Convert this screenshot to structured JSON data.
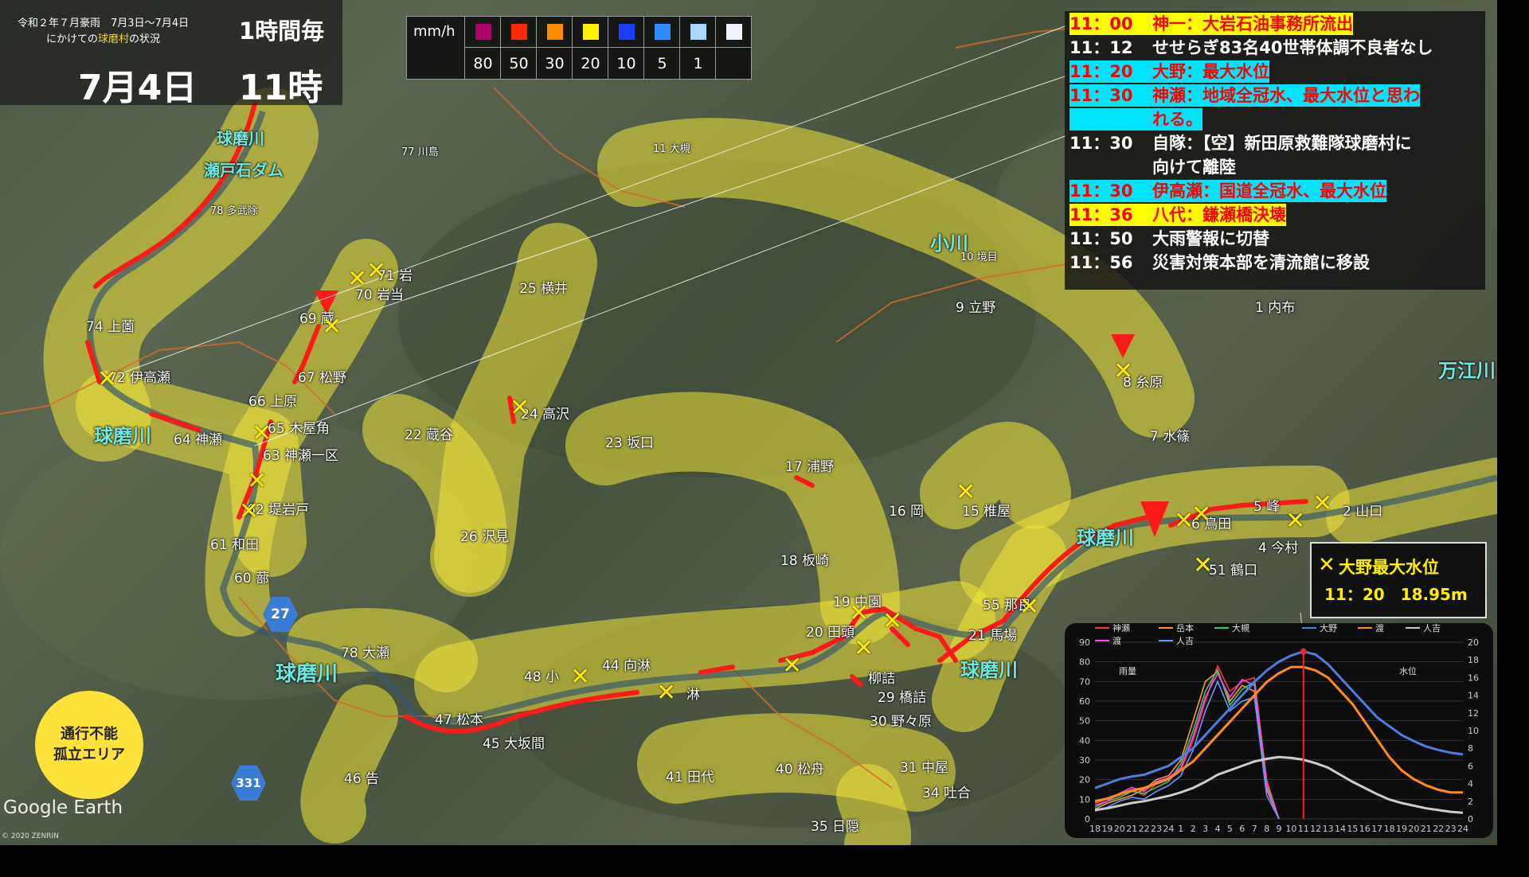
{
  "title": {
    "line1": "令和２年７月豪雨　7月3日～7月4日",
    "line2_prefix": "にかけての",
    "line2_highlight": "球磨村",
    "line2_suffix": "の状況",
    "interval": "1時間毎",
    "date": "7月4日",
    "hour": "11時"
  },
  "rain_legend": {
    "unit": "mm/h",
    "colors": [
      "#b0006e",
      "#ff2a00",
      "#ff8c00",
      "#fff000",
      "#1a3cff",
      "#2c8cff",
      "#a8d8ff",
      "#f0f4ff"
    ],
    "values": [
      "80",
      "50",
      "30",
      "20",
      "10",
      "5",
      "1",
      ""
    ]
  },
  "timeline": [
    {
      "time": "11：00",
      "text": "神一：大岩石油事務所流出",
      "style": "hl"
    },
    {
      "time": "11：12",
      "text": "せせらぎ83名40世帯体調不良者なし",
      "style": "nrm"
    },
    {
      "time": "11：20",
      "text": "大野：最大水位",
      "style": "hl2"
    },
    {
      "time": "11：30",
      "text": "神瀬：地域全冠水、最大水位と思わ",
      "style": "hl2"
    },
    {
      "time": "",
      "text": "れる。",
      "style": "hl2"
    },
    {
      "time": "11：30",
      "text": "自隊：【空】新田原救難隊球磨村に",
      "style": "nrm"
    },
    {
      "time": "",
      "text": "向けて離陸",
      "style": "nrm"
    },
    {
      "time": "11：30",
      "text": "伊高瀬：国道全冠水、最大水位",
      "style": "hl2"
    },
    {
      "time": "11：36",
      "text": "八代：鎌瀬橋決壊",
      "style": "hl"
    },
    {
      "time": "11：50",
      "text": "大雨警報に切替",
      "style": "nrm"
    },
    {
      "time": "11：56",
      "text": "災害対策本部を清流館に移設",
      "style": "nrm"
    }
  ],
  "callout": {
    "line1": "大野最大水位",
    "time": "11：20",
    "level": "18.95m"
  },
  "isolation_legend": {
    "line1": "通行不能",
    "line2": "孤立エリア"
  },
  "attribution": {
    "google": "Google Earth",
    "copy": "© 2020 ZENRIN"
  },
  "places": [
    {
      "label": "77 川島"
    },
    {
      "label": "78 多武除"
    },
    {
      "label": "74 上薗"
    },
    {
      "label": "72 伊高瀬"
    },
    {
      "label": "71 岩"
    },
    {
      "label": "70 岩当"
    },
    {
      "label": "69 蔵"
    },
    {
      "label": "67 松野"
    },
    {
      "label": "66 上原"
    },
    {
      "label": "65 木屋角"
    },
    {
      "label": "64 神瀬"
    },
    {
      "label": "63 神瀬一区"
    },
    {
      "label": "62 堤岩戸"
    },
    {
      "label": "61 和田"
    },
    {
      "label": "60 蔀"
    },
    {
      "label": "78 大瀬"
    },
    {
      "label": "46 告"
    },
    {
      "label": "47 松本"
    },
    {
      "label": "45 大坂間"
    },
    {
      "label": "48 小"
    },
    {
      "label": "44 向淋"
    },
    {
      "label": "41 田代"
    },
    {
      "label": "40 松舟"
    },
    {
      "label": "35 日隠"
    },
    {
      "label": "34 吐合"
    },
    {
      "label": "31 中屋"
    },
    {
      "label": "30 野々原"
    },
    {
      "label": "29 橋詰"
    },
    {
      "label": "柳詰"
    },
    {
      "label": "19 中園"
    },
    {
      "label": "20 田頭"
    },
    {
      "label": "17 浦野"
    },
    {
      "label": "18 板崎"
    },
    {
      "label": "16 岡"
    },
    {
      "label": "15 椎屋"
    },
    {
      "label": "55 那良"
    },
    {
      "label": "21 馬場"
    },
    {
      "label": "22 蔵谷"
    },
    {
      "label": "23 坂口"
    },
    {
      "label": "25 横井"
    },
    {
      "label": "24 高沢"
    },
    {
      "label": "26 沢見"
    },
    {
      "label": "11 大槻"
    },
    {
      "label": "10 境目"
    },
    {
      "label": "9 立野"
    },
    {
      "label": "8 糸原"
    },
    {
      "label": "7 水篠"
    },
    {
      "label": "1 内布"
    },
    {
      "label": "5 峰"
    },
    {
      "label": "6 鳥田"
    },
    {
      "label": "4 今村"
    },
    {
      "label": "2 山口"
    },
    {
      "label": "51 鶴口"
    },
    {
      "label": "淋"
    }
  ],
  "rivers": [
    "球磨川",
    "瀬戸石ダム",
    "球磨川",
    "球磨川",
    "球磨川",
    "球磨川",
    "小川",
    "万江川"
  ],
  "route_signs": [
    "27",
    "331"
  ],
  "chart_data": {
    "type": "line",
    "x": [
      "18",
      "19",
      "20",
      "21",
      "22",
      "23",
      "24",
      "1",
      "2",
      "3",
      "4",
      "5",
      "6",
      "7",
      "8",
      "9",
      "10",
      "11",
      "12",
      "13",
      "14",
      "15",
      "16",
      "17",
      "18",
      "19",
      "20",
      "21",
      "22",
      "23",
      "24"
    ],
    "left_axis": {
      "label": "雨量",
      "ylim": [
        0,
        90
      ],
      "ticks": [
        0,
        10,
        20,
        30,
        40,
        50,
        60,
        70,
        80,
        90
      ]
    },
    "right_axis": {
      "label": "水位",
      "ylim": [
        0,
        20
      ],
      "ticks": [
        0,
        2,
        4,
        6,
        8,
        10,
        12,
        14,
        16,
        18,
        20
      ]
    },
    "rain_series": [
      {
        "name": "神瀬",
        "color": "#ff3333",
        "values": [
          8,
          10,
          12,
          15,
          12,
          18,
          20,
          25,
          40,
          60,
          78,
          65,
          70,
          72,
          20,
          0
        ]
      },
      {
        "name": "岳本",
        "color": "#ff9933",
        "values": [
          5,
          8,
          10,
          12,
          15,
          20,
          22,
          30,
          50,
          70,
          75,
          60,
          68,
          65,
          15,
          0
        ]
      },
      {
        "name": "大槻",
        "color": "#33cc66",
        "values": [
          6,
          9,
          11,
          14,
          13,
          16,
          19,
          28,
          45,
          65,
          76,
          58,
          66,
          70,
          18,
          0
        ]
      },
      {
        "name": "渡",
        "color": "#ff44ff",
        "values": [
          7,
          9,
          13,
          16,
          14,
          19,
          21,
          26,
          42,
          62,
          74,
          62,
          71,
          68,
          16,
          0
        ]
      },
      {
        "name": "人吉",
        "color": "#6699ff",
        "values": [
          4,
          6,
          9,
          11,
          10,
          14,
          17,
          22,
          35,
          55,
          70,
          55,
          60,
          62,
          12,
          0
        ]
      }
    ],
    "level_series": [
      {
        "name": "大野",
        "color": "#4a7fe0",
        "values": [
          3.5,
          4,
          4.5,
          4.8,
          5,
          5.5,
          6,
          7,
          8,
          9.5,
          11,
          12.5,
          14,
          15.5,
          16.8,
          17.8,
          18.5,
          18.95,
          18.6,
          17.5,
          16,
          14.5,
          13,
          11.5,
          10.5,
          9.5,
          8.8,
          8.2,
          7.8,
          7.5,
          7.3
        ]
      },
      {
        "name": "渡",
        "color": "#ff8c1a",
        "values": [
          2,
          2.3,
          2.8,
          3.2,
          3.5,
          4,
          4.5,
          5.5,
          6.5,
          8,
          9.5,
          11,
          12.5,
          14,
          15.5,
          16.5,
          17.2,
          17.2,
          16.8,
          16,
          14.5,
          13,
          11,
          9,
          7,
          5.5,
          4.5,
          3.8,
          3.3,
          3,
          3
        ]
      },
      {
        "name": "人吉",
        "color": "#cccccc",
        "values": [
          1,
          1.2,
          1.5,
          1.8,
          2,
          2.3,
          2.6,
          3,
          3.5,
          4.2,
          5,
          5.5,
          6,
          6.5,
          6.8,
          7,
          6.9,
          6.7,
          6.3,
          5.8,
          5,
          4.2,
          3.5,
          2.8,
          2.2,
          1.8,
          1.5,
          1.2,
          1,
          0.8,
          0.7
        ]
      }
    ],
    "peak_marker": {
      "x": "11",
      "value": 18.95
    }
  }
}
